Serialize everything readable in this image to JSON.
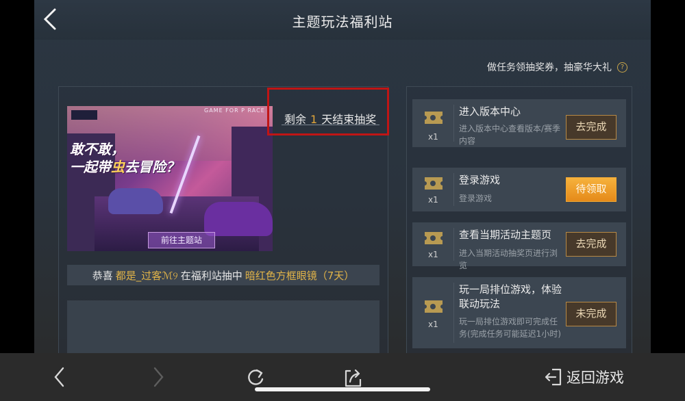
{
  "header": {
    "title": "主题玩法福利站"
  },
  "subtitle": "做任务领抽奖券，抽豪华大礼",
  "help_icon_glyph": "?",
  "banner": {
    "game_for": "GAME FOR P          RACE",
    "headline_line1": "敢不敢，",
    "headline_line2_a": "一起带",
    "headline_line2_accent": "虫",
    "headline_line2_b": "去冒险？",
    "enter_label": "前往主题站"
  },
  "countdown": {
    "prefix": "剩余",
    "days": "1",
    "suffix": "天结束抽奖"
  },
  "winner": {
    "prefix": "恭喜",
    "user": "都是_过客ℳ୨",
    "middle": "在福利站抽中",
    "prize": "暗红色方框眼镜（7天）"
  },
  "tasks": [
    {
      "name": "进入版本中心",
      "desc": "进入版本中心查看版本/赛季内容",
      "count": "x1",
      "button": "去完成"
    },
    {
      "name": "登录游戏",
      "desc": "登录游戏",
      "count": "x1",
      "button": "待领取"
    },
    {
      "name": "查看当期活动主题页",
      "desc": "进入当期活动抽奖页进行浏览",
      "count": "x1",
      "button": "去完成"
    },
    {
      "name": "玩一局排位游戏，体验联动玩法",
      "desc": "玩一局排位游戏即可完成任务(完成任务可能延迟1小时)",
      "count": "x1",
      "button": "未完成"
    }
  ],
  "bottom": {
    "return_label": "返回游戏"
  },
  "colors": {
    "accent_gold": "#e2b448",
    "claim_orange": "#f0a935",
    "highlight_red": "#c01515"
  }
}
